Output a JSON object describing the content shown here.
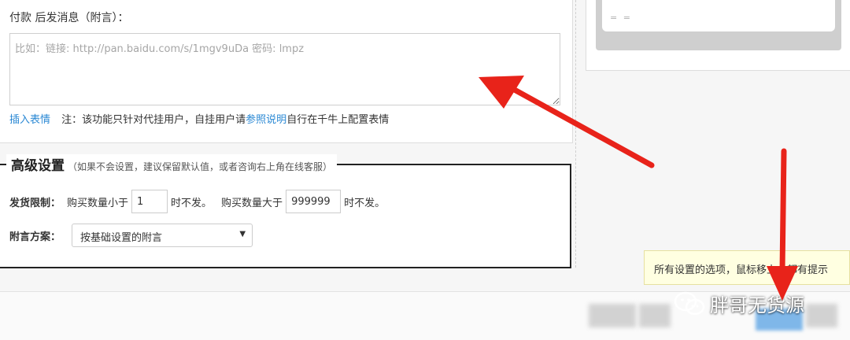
{
  "message_section": {
    "label": "付款 后发消息（附言）：",
    "textarea_placeholder": "比如：链接: http://pan.baidu.com/s/1mgv9uDa 密码: lmpz",
    "insert_emoji_link": "插入表情",
    "note_prefix": "注：该功能只针对代挂用户，自挂用户请",
    "note_link": "参照说明",
    "note_suffix": "自行在千牛上配置表情"
  },
  "preview": {
    "text": "= ="
  },
  "advanced": {
    "title": "高级设置",
    "hint": "（如果不会设置，建议保留默认值，或者咨询右上角在线客服）",
    "ship_limit": {
      "label": "发货限制：",
      "text_less": "购买数量小于",
      "min_value": "1",
      "text_no_ship_1": "时不发。",
      "text_greater": "购买数量大于",
      "max_value": "999999",
      "text_no_ship_2": "时不发。"
    },
    "note_plan": {
      "label": "附言方案：",
      "selected": "按基础设置的附言"
    }
  },
  "tooltip": {
    "text": "所有设置的选项，鼠标移上去都有提示"
  },
  "watermark": {
    "text": "胖哥无货源",
    "icon": "wechat-icon"
  },
  "colors": {
    "link": "#2a88d4",
    "arrow": "#e8231a",
    "tooltip_bg": "#ffffe1"
  }
}
